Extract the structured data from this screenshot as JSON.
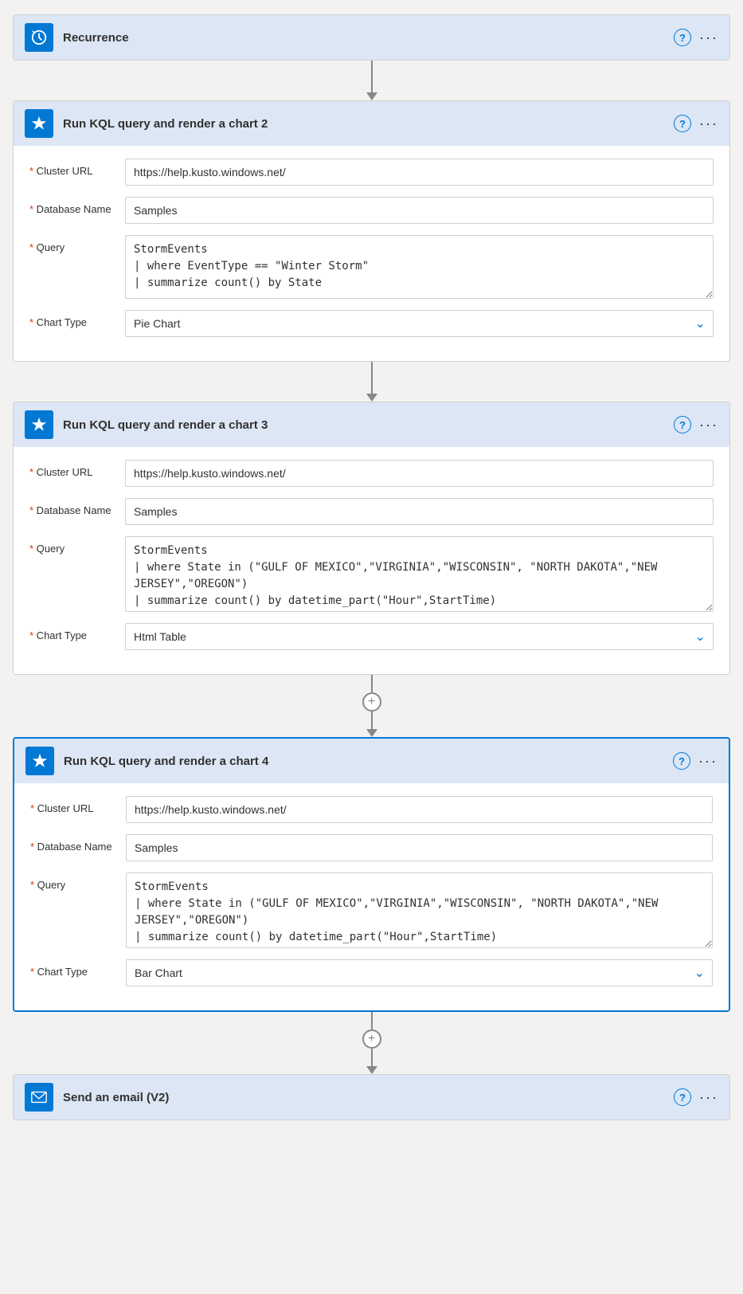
{
  "recurrence": {
    "title": "Recurrence",
    "help_label": "?",
    "dots_label": "···"
  },
  "step2": {
    "title": "Run KQL query and render a chart 2",
    "help_label": "?",
    "dots_label": "···",
    "fields": {
      "cluster_url_label": "* Cluster URL",
      "cluster_url_value": "https://help.kusto.windows.net/",
      "database_name_label": "* Database Name",
      "database_name_value": "Samples",
      "query_label": "* Query",
      "query_value": "StormEvents\n| where EventType == \"Winter Storm\"\n| summarize count() by State",
      "chart_type_label": "* Chart Type",
      "chart_type_value": "Pie Chart"
    }
  },
  "step3": {
    "title": "Run KQL query and render a chart 3",
    "help_label": "?",
    "dots_label": "···",
    "fields": {
      "cluster_url_label": "* Cluster URL",
      "cluster_url_value": "https://help.kusto.windows.net/",
      "database_name_label": "* Database Name",
      "database_name_value": "Samples",
      "query_label": "* Query",
      "query_value": "StormEvents\n| where State in (\"GULF OF MEXICO\",\"VIRGINIA\",\"WISCONSIN\", \"NORTH DAKOTA\",\"NEW JERSEY\",\"OREGON\")\n| summarize count() by datetime_part(\"Hour\",StartTime)",
      "chart_type_label": "* Chart Type",
      "chart_type_value": "Html Table"
    }
  },
  "step4": {
    "title": "Run KQL query and render a chart 4",
    "help_label": "?",
    "dots_label": "···",
    "fields": {
      "cluster_url_label": "* Cluster URL",
      "cluster_url_value": "https://help.kusto.windows.net/",
      "database_name_label": "* Database Name",
      "database_name_value": "Samples",
      "query_label": "* Query",
      "query_value": "StormEvents\n| where State in (\"GULF OF MEXICO\",\"VIRGINIA\",\"WISCONSIN\", \"NORTH DAKOTA\",\"NEW JERSEY\",\"OREGON\")\n| summarize count() by datetime_part(\"Hour\",StartTime)",
      "chart_type_label": "* Chart Type",
      "chart_type_value": "Bar Chart"
    }
  },
  "send_email": {
    "title": "Send an email (V2)",
    "help_label": "?",
    "dots_label": "···"
  },
  "plus_label": "+"
}
